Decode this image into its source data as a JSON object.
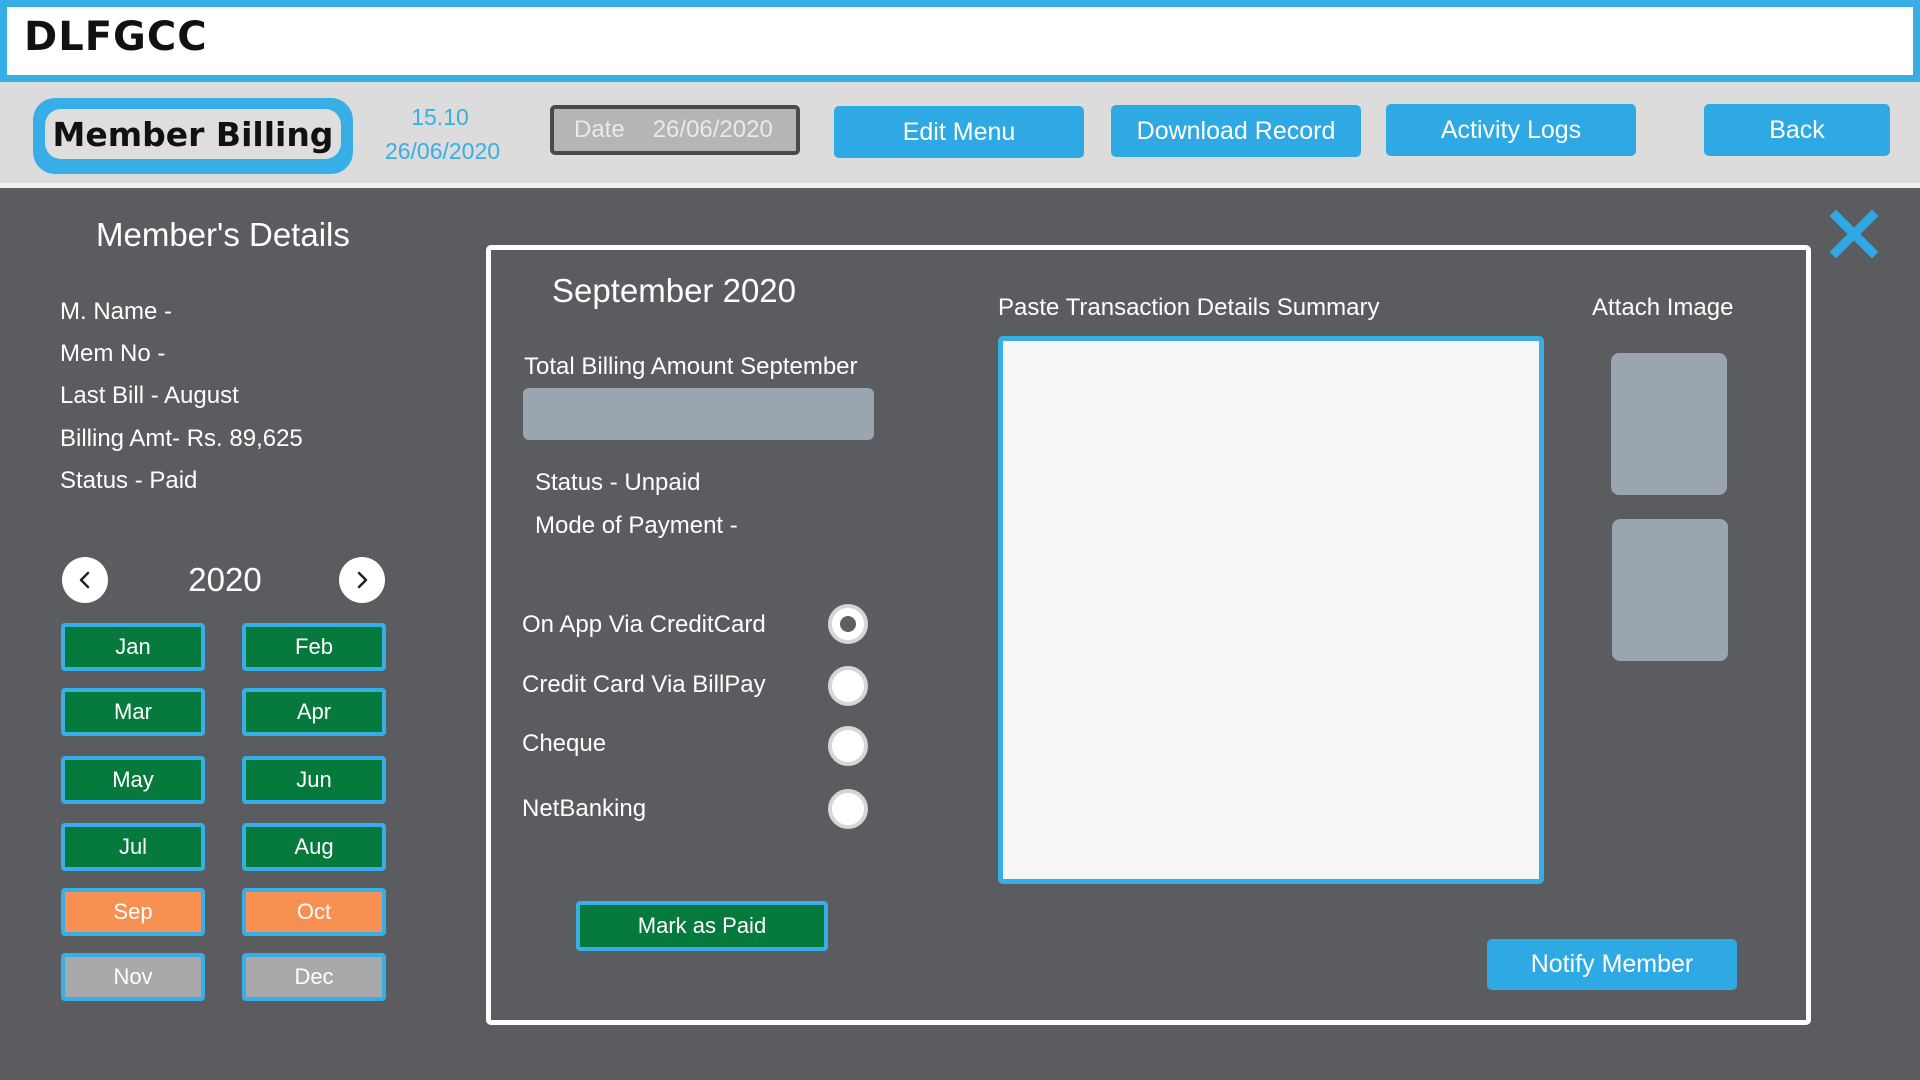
{
  "app": {
    "title": "DLFGCC"
  },
  "header": {
    "section_label": "Member Billing",
    "time": "15.10",
    "date": "26/06/2020",
    "date_field_label": "Date",
    "date_field_value": "26/06/2020",
    "buttons": {
      "edit": "Edit Menu",
      "download": "Download Record",
      "logs": "Activity Logs",
      "back": "Back"
    }
  },
  "member_details": {
    "title": "Member's Details",
    "name": "M. Name -",
    "mem_no": "Mem No -",
    "last_bill": "Last Bill - August",
    "billing_amt": "Billing Amt- Rs. 89,625",
    "status": "Status - Paid"
  },
  "calendar": {
    "year": "2020",
    "prev_icon": "chevron-left-icon",
    "next_icon": "chevron-right-icon",
    "months": [
      {
        "label": "Jan",
        "state": "paid"
      },
      {
        "label": "Feb",
        "state": "paid"
      },
      {
        "label": "Mar",
        "state": "paid"
      },
      {
        "label": "Apr",
        "state": "paid"
      },
      {
        "label": "May",
        "state": "paid"
      },
      {
        "label": "Jun",
        "state": "paid"
      },
      {
        "label": "Jul",
        "state": "paid"
      },
      {
        "label": "Aug",
        "state": "paid"
      },
      {
        "label": "Sep",
        "state": "current"
      },
      {
        "label": "Oct",
        "state": "current"
      },
      {
        "label": "Nov",
        "state": "future"
      },
      {
        "label": "Dec",
        "state": "future"
      }
    ]
  },
  "billing": {
    "month_title": "September 2020",
    "total_label": "Total Billing Amount September",
    "total_value": "",
    "status": "Status - Unpaid",
    "mode_label": "Mode of Payment -",
    "payment_options": [
      {
        "label": "On App Via CreditCard",
        "selected": true
      },
      {
        "label": "Credit Card Via BillPay",
        "selected": false
      },
      {
        "label": "Cheque",
        "selected": false
      },
      {
        "label": "NetBanking",
        "selected": false
      }
    ],
    "mark_paid": "Mark as Paid",
    "paste_label": "Paste Transaction Details Summary",
    "paste_value": "",
    "attach_label": "Attach Image",
    "notify": "Notify Member"
  },
  "colors": {
    "accent": "#38aee6",
    "paid": "#057a3c",
    "current": "#f89052",
    "future": "#a9a9a9",
    "background": "#5b5c60"
  }
}
